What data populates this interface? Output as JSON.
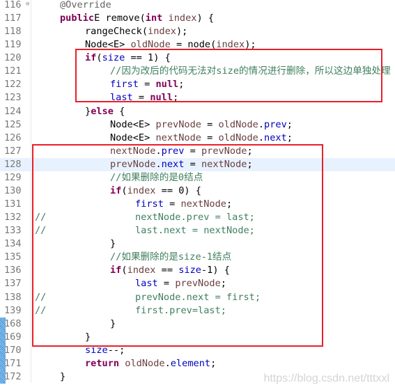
{
  "colors": {
    "keyword": "#7f0055",
    "field": "#0000c0",
    "local": "#6a3e3e",
    "comment": "#3f7f5f",
    "annotation": "#646464",
    "highlight": "#e8f2fe",
    "box": "#e8202a"
  },
  "lines": [
    {
      "n": "116",
      "i": 1,
      "fold": true,
      "t": [
        [
          "ann",
          "@Override"
        ]
      ]
    },
    {
      "n": "117",
      "i": 1,
      "t": [
        [
          "kw",
          "public"
        ],
        [
          "",
          "E remove("
        ],
        [
          "kw",
          "int"
        ],
        [
          "",
          " "
        ],
        [
          "local",
          "index"
        ],
        [
          "",
          ") {"
        ]
      ]
    },
    {
      "n": "118",
      "i": 2,
      "t": [
        [
          "",
          "rangeCheck("
        ],
        [
          "local",
          "index"
        ],
        [
          "",
          ");"
        ]
      ]
    },
    {
      "n": "119",
      "i": 2,
      "t": [
        [
          "",
          "Node<E> "
        ],
        [
          "local",
          "oldNode"
        ],
        [
          "",
          " = node("
        ],
        [
          "local",
          "index"
        ],
        [
          "",
          ");"
        ]
      ]
    },
    {
      "n": "120",
      "i": 2,
      "t": [
        [
          "kw",
          "if"
        ],
        [
          "",
          "("
        ],
        [
          "field",
          "size"
        ],
        [
          "",
          " == 1) {"
        ]
      ]
    },
    {
      "n": "121",
      "i": 3,
      "t": [
        [
          "cm",
          "//因为改后的代码无法对size的情况进行删除，所以这边单独处理"
        ]
      ]
    },
    {
      "n": "122",
      "i": 3,
      "t": [
        [
          "field",
          "first"
        ],
        [
          "",
          " = "
        ],
        [
          "kw",
          "null"
        ],
        [
          "",
          ";"
        ]
      ]
    },
    {
      "n": "123",
      "i": 3,
      "t": [
        [
          "field",
          "last"
        ],
        [
          "",
          " = "
        ],
        [
          "kw",
          "null"
        ],
        [
          "",
          ";"
        ]
      ]
    },
    {
      "n": "124",
      "i": 2,
      "t": [
        [
          "",
          "}"
        ],
        [
          "kw",
          "else"
        ],
        [
          "",
          " {"
        ]
      ]
    },
    {
      "n": "125",
      "i": 3,
      "t": [
        [
          "",
          "Node<E> "
        ],
        [
          "local",
          "prevNode"
        ],
        [
          "",
          " = "
        ],
        [
          "local",
          "oldNode"
        ],
        [
          "",
          "."
        ],
        [
          "field",
          "prev"
        ],
        [
          "",
          ";"
        ]
      ]
    },
    {
      "n": "126",
      "i": 3,
      "t": [
        [
          "",
          "Node<E> "
        ],
        [
          "local",
          "nextNode"
        ],
        [
          "",
          " = "
        ],
        [
          "local",
          "oldNode"
        ],
        [
          "",
          "."
        ],
        [
          "field",
          "next"
        ],
        [
          "",
          ";"
        ]
      ]
    },
    {
      "n": "127",
      "i": 3,
      "t": [
        [
          "local",
          "nextNode"
        ],
        [
          "",
          "."
        ],
        [
          "field",
          "prev"
        ],
        [
          "",
          " = "
        ],
        [
          "local",
          "prevNode"
        ],
        [
          "",
          ";"
        ]
      ]
    },
    {
      "n": "128",
      "i": 3,
      "hl": true,
      "t": [
        [
          "local",
          "prevNode"
        ],
        [
          "",
          "."
        ],
        [
          "field",
          "next"
        ],
        [
          "",
          " = "
        ],
        [
          "local",
          "nextNode"
        ],
        [
          "",
          ";"
        ]
      ]
    },
    {
      "n": "129",
      "i": 3,
      "t": [
        [
          "cm",
          "//如果删除的是0结点"
        ]
      ]
    },
    {
      "n": "130",
      "i": 3,
      "t": [
        [
          "kw",
          "if"
        ],
        [
          "",
          "("
        ],
        [
          "local",
          "index"
        ],
        [
          "",
          " == 0) {"
        ]
      ]
    },
    {
      "n": "131",
      "i": 4,
      "t": [
        [
          "field",
          "first"
        ],
        [
          "",
          " = "
        ],
        [
          "local",
          "nextNode"
        ],
        [
          "",
          ";"
        ]
      ]
    },
    {
      "n": "132",
      "i": 4,
      "cm": "//",
      "t": [
        [
          "cm",
          "nextNode.prev = last;"
        ]
      ]
    },
    {
      "n": "133",
      "i": 4,
      "cm": "//",
      "t": [
        [
          "cm",
          "last.next = nextNode;"
        ]
      ]
    },
    {
      "n": "134",
      "i": 3,
      "t": [
        [
          "",
          "}"
        ]
      ]
    },
    {
      "n": "135",
      "i": 3,
      "t": [
        [
          "cm",
          "//如果删除的是size-1结点"
        ]
      ]
    },
    {
      "n": "136",
      "i": 3,
      "t": [
        [
          "kw",
          "if"
        ],
        [
          "",
          "("
        ],
        [
          "local",
          "index"
        ],
        [
          "",
          " == "
        ],
        [
          "field",
          "size"
        ],
        [
          "",
          "-1) {"
        ]
      ]
    },
    {
      "n": "137",
      "i": 4,
      "t": [
        [
          "field",
          "last"
        ],
        [
          "",
          " = "
        ],
        [
          "local",
          "prevNode"
        ],
        [
          "",
          ";"
        ]
      ]
    },
    {
      "n": "138",
      "i": 4,
      "cm": "//",
      "t": [
        [
          "cm",
          "prevNode.next = first;"
        ]
      ]
    },
    {
      "n": "139",
      "i": 4,
      "cm": "//",
      "t": [
        [
          "cm",
          "first.prev=last;"
        ]
      ]
    },
    {
      "n": "168",
      "i": 3,
      "chg": true,
      "t": [
        [
          "",
          "}"
        ]
      ]
    },
    {
      "n": "169",
      "i": 2,
      "chg": true,
      "t": [
        [
          "",
          "}"
        ]
      ]
    },
    {
      "n": "170",
      "i": 2,
      "chg": true,
      "t": [
        [
          "field",
          "size"
        ],
        [
          "",
          "--;"
        ]
      ]
    },
    {
      "n": "171",
      "i": 2,
      "chg": true,
      "t": [
        [
          "kw",
          "return"
        ],
        [
          "",
          " "
        ],
        [
          "local",
          "oldNode"
        ],
        [
          "",
          "."
        ],
        [
          "field",
          "element"
        ],
        [
          "",
          ";"
        ]
      ]
    },
    {
      "n": "172",
      "i": 1,
      "chg": true,
      "t": [
        [
          "",
          "}"
        ]
      ]
    }
  ],
  "watermark": "https://blog.csdn.net/tttxxl"
}
